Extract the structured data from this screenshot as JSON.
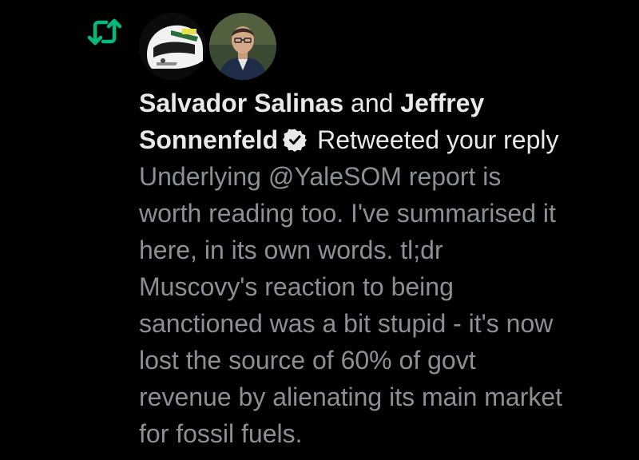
{
  "notification": {
    "icon": "retweet-icon",
    "accent_color": "#00ba7c",
    "users": [
      {
        "name": "Salvador Salinas",
        "avatar": "racing-helmet"
      },
      {
        "name": "Jeffrey Sonnenfeld",
        "avatar": "profile-photo",
        "verified": true
      }
    ],
    "connector": "and",
    "action": "Retweeted your reply",
    "reply_text": "Underlying @YaleSOM report is\nworth reading too. I've summarised it\nhere, in its own words. tl;dr\nMuscovy's reaction to being\nsanctioned was a bit stupid - it's now\nlost the source of 60% of govt\nrevenue by alienating its main market\nfor fossil fuels."
  }
}
